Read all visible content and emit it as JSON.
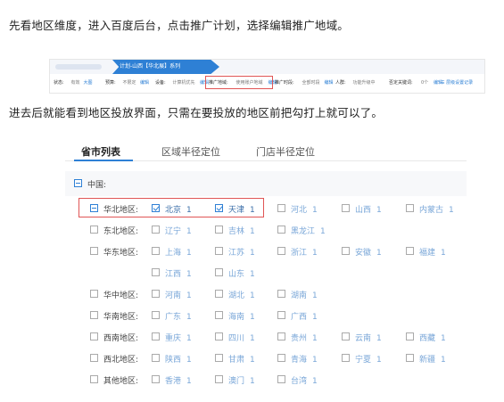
{
  "intro_text": "先看地区维度，进入百度后台，点击推广计划，选择编辑推广地域。",
  "second_text": "进去后就能看到地区投放界面，只需在要投放的地区前把勾打上就可以了。",
  "top_screenshot": {
    "breadcrumb_tab": "计划-山西【华北展】系列",
    "settings": [
      {
        "label": "状态:",
        "value": "有效",
        "link": "大图"
      },
      {
        "label": "预算:",
        "value": "不限定",
        "link": "编辑"
      },
      {
        "label": "设备:",
        "value": "计算机优先",
        "link": "编辑"
      },
      {
        "label": "推广地域:",
        "value": "使用账户地域",
        "link": "编辑"
      },
      {
        "label": "推广时段:",
        "value": "全部时段",
        "link": "编辑"
      },
      {
        "label": "人群:",
        "value": "功能升级中",
        "link": ""
      },
      {
        "label": "否定关键词:",
        "value": "0个",
        "link": "编辑"
      },
      {
        "label": "",
        "value": "",
        "link": "☰ 层级设置记录"
      }
    ]
  },
  "region_panel": {
    "tabs": [
      "省市列表",
      "区域半径定位",
      "门店半径定位"
    ],
    "country_label": "中国:",
    "regions": [
      {
        "name": "华北地区:",
        "provinces": [
          {
            "name": "北京",
            "count": "1",
            "checked": true
          },
          {
            "name": "天津",
            "count": "1",
            "checked": true
          },
          {
            "name": "河北",
            "count": "1",
            "checked": false
          },
          {
            "name": "山西",
            "count": "1",
            "checked": false
          },
          {
            "name": "内蒙古",
            "count": "1",
            "checked": false
          }
        ]
      },
      {
        "name": "东北地区:",
        "provinces": [
          {
            "name": "辽宁",
            "count": "1",
            "checked": false
          },
          {
            "name": "吉林",
            "count": "1",
            "checked": false
          },
          {
            "name": "黑龙江",
            "count": "1",
            "checked": false
          }
        ]
      },
      {
        "name": "华东地区:",
        "provinces": [
          {
            "name": "上海",
            "count": "1",
            "checked": false
          },
          {
            "name": "江苏",
            "count": "1",
            "checked": false
          },
          {
            "name": "浙江",
            "count": "1",
            "checked": false
          },
          {
            "name": "安徽",
            "count": "1",
            "checked": false
          },
          {
            "name": "福建",
            "count": "1",
            "checked": false
          },
          {
            "name": "江西",
            "count": "1",
            "checked": false
          },
          {
            "name": "山东",
            "count": "1",
            "checked": false
          }
        ]
      },
      {
        "name": "华中地区:",
        "provinces": [
          {
            "name": "河南",
            "count": "1",
            "checked": false
          },
          {
            "name": "湖北",
            "count": "1",
            "checked": false
          },
          {
            "name": "湖南",
            "count": "1",
            "checked": false
          }
        ]
      },
      {
        "name": "华南地区:",
        "provinces": [
          {
            "name": "广东",
            "count": "1",
            "checked": false
          },
          {
            "name": "海南",
            "count": "1",
            "checked": false
          },
          {
            "name": "广西",
            "count": "1",
            "checked": false
          }
        ]
      },
      {
        "name": "西南地区:",
        "provinces": [
          {
            "name": "重庆",
            "count": "1",
            "checked": false
          },
          {
            "name": "四川",
            "count": "1",
            "checked": false
          },
          {
            "name": "贵州",
            "count": "1",
            "checked": false
          },
          {
            "name": "云南",
            "count": "1",
            "checked": false
          },
          {
            "name": "西藏",
            "count": "1",
            "checked": false
          }
        ]
      },
      {
        "name": "西北地区:",
        "provinces": [
          {
            "name": "陕西",
            "count": "1",
            "checked": false
          },
          {
            "name": "甘肃",
            "count": "1",
            "checked": false
          },
          {
            "name": "青海",
            "count": "1",
            "checked": false
          },
          {
            "name": "宁夏",
            "count": "1",
            "checked": false
          },
          {
            "name": "新疆",
            "count": "1",
            "checked": false
          }
        ]
      },
      {
        "name": "其他地区:",
        "provinces": [
          {
            "name": "香港",
            "count": "1",
            "checked": false
          },
          {
            "name": "澳门",
            "count": "1",
            "checked": false
          },
          {
            "name": "台湾",
            "count": "1",
            "checked": false
          }
        ]
      }
    ]
  },
  "colors": {
    "accent": "#2e80d5",
    "highlight": "#e05555",
    "province_text": "#7aa7d8"
  }
}
